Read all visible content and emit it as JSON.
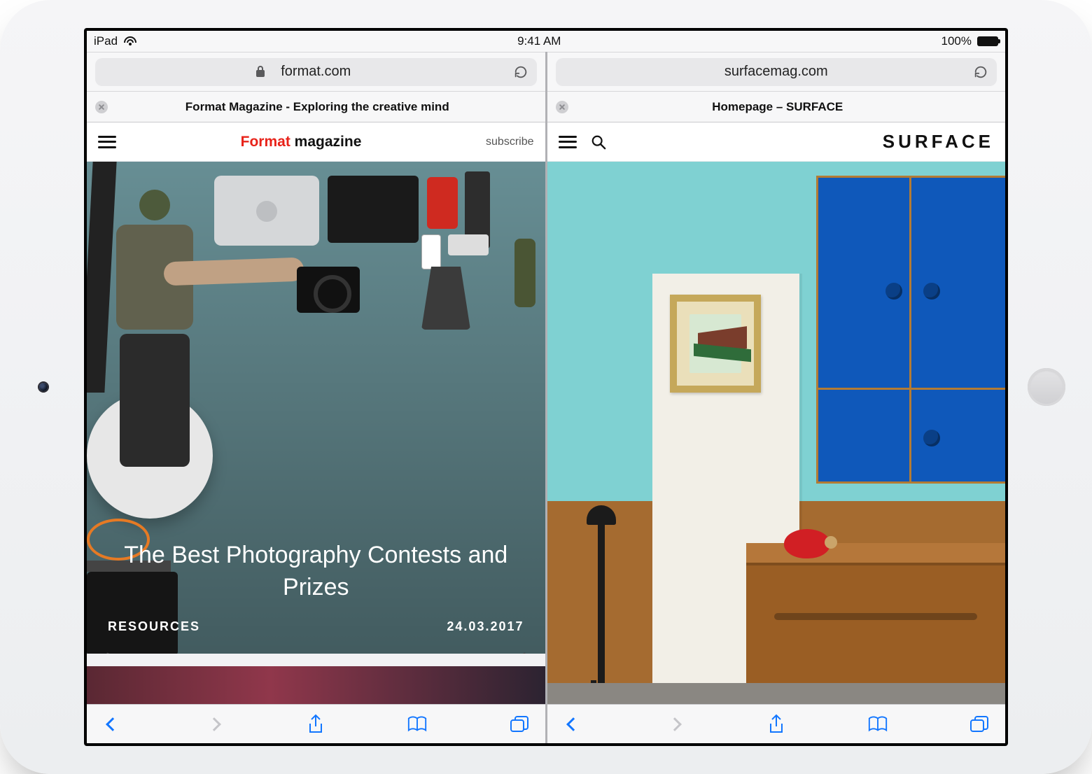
{
  "status": {
    "device": "iPad",
    "time": "9:41 AM",
    "battery_pct": "100%"
  },
  "left": {
    "url": "format.com",
    "tab_title": "Format Magazine - Exploring the creative mind",
    "brand_a": "Format",
    "brand_b": "magazine",
    "subscribe": "subscribe",
    "hero_title": "The Best Photography Contests and Prizes",
    "hero_category": "RESOURCES",
    "hero_date": "24.03.2017"
  },
  "right": {
    "url": "surfacemag.com",
    "tab_title": "Homepage – SURFACE",
    "brand": "SURFACE"
  }
}
